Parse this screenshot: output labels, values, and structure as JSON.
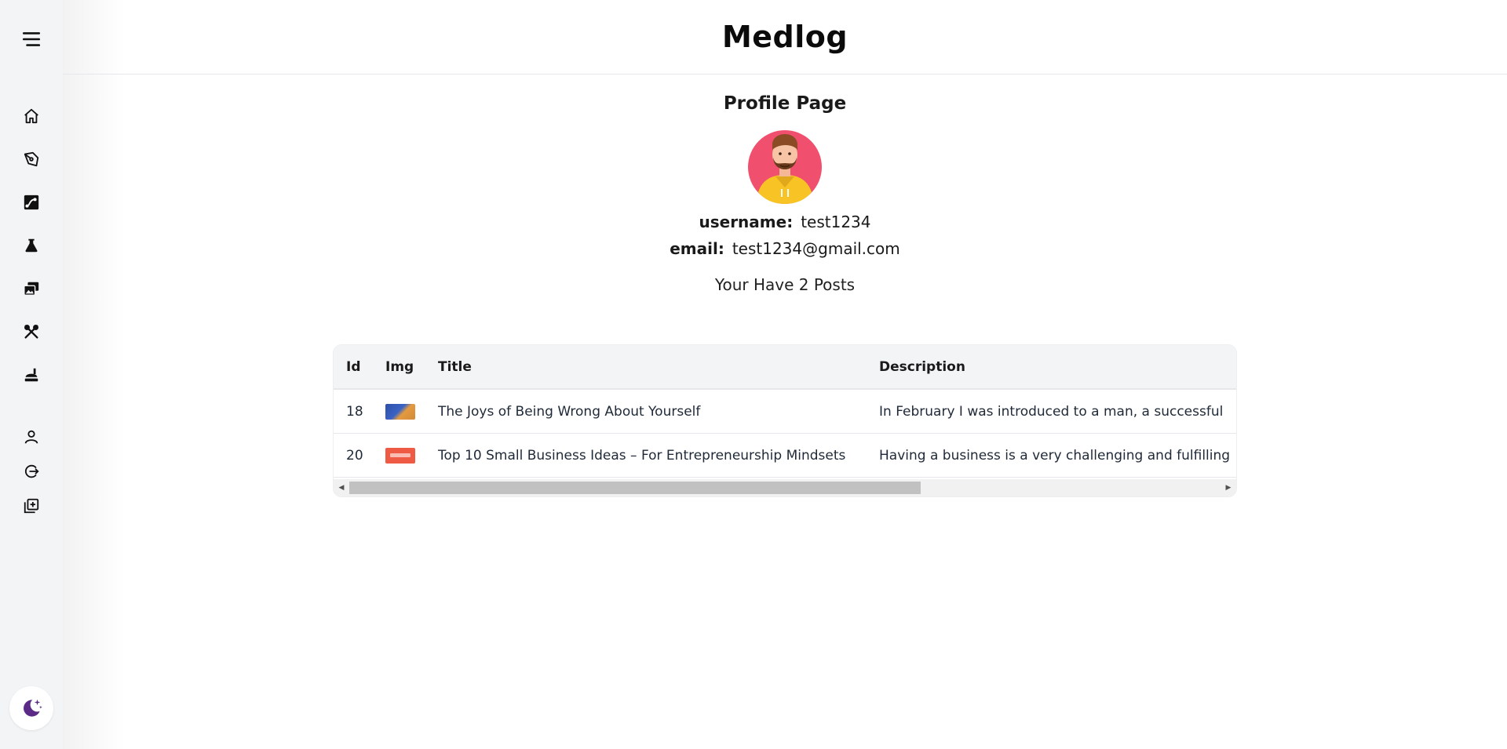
{
  "app": {
    "title": "Medlog"
  },
  "sidebar": {
    "menu_icon": "hamburger-menu-icon",
    "items": [
      {
        "name": "home",
        "icon": "home-icon"
      },
      {
        "name": "write",
        "icon": "pen-nib-icon"
      },
      {
        "name": "recipes",
        "icon": "map-route-icon"
      },
      {
        "name": "science",
        "icon": "flask-icon"
      },
      {
        "name": "travel",
        "icon": "photos-icon"
      },
      {
        "name": "tools",
        "icon": "tools-icon"
      },
      {
        "name": "food",
        "icon": "food-icon"
      }
    ],
    "account": [
      {
        "name": "profile",
        "icon": "user-icon"
      },
      {
        "name": "logout",
        "icon": "logout-icon"
      },
      {
        "name": "new-post",
        "icon": "add-post-icon"
      }
    ],
    "theme_icon": "moon-stars-icon"
  },
  "profile": {
    "page_title": "Profile Page",
    "username_label": "username:",
    "username": "test1234",
    "email_label": "email:",
    "email": "test1234@gmail.com",
    "posts_count_text": "Your Have 2 Posts"
  },
  "table": {
    "headers": {
      "id": "Id",
      "img": "Img",
      "title": "Title",
      "description": "Description"
    },
    "rows": [
      {
        "id": "18",
        "title": "The Joys of Being Wrong About Yourself",
        "description": "In February I was introduced to a man, a successful"
      },
      {
        "id": "20",
        "title": "Top 10 Small Business Ideas – For Entrepreneurship Mindsets",
        "description": "Having a business is a very challenging and fulfilling"
      }
    ]
  },
  "colors": {
    "sidebar_bg": "#f3f4f6",
    "table_header_bg": "#f3f4f6",
    "accent_purple": "#5b2a86"
  }
}
